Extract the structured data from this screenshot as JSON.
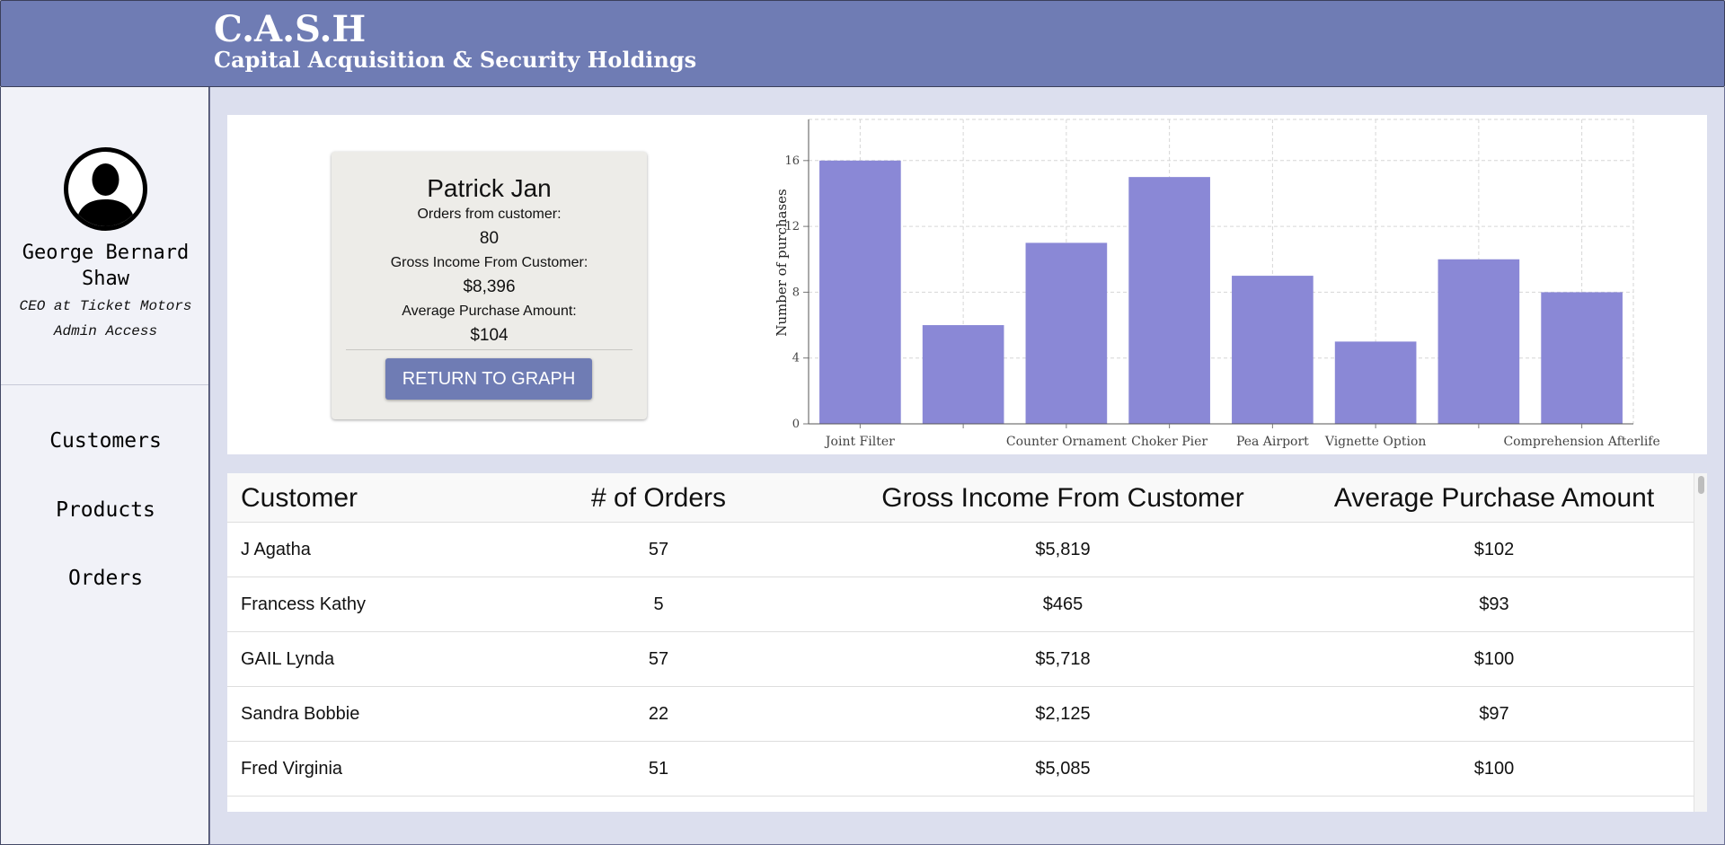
{
  "header": {
    "title": "C.A.S.H",
    "subtitle": "Capital Acquisition & Security Holdings"
  },
  "profile": {
    "name": "George Bernard Shaw",
    "role": "CEO at Ticket Motors",
    "access": "Admin Access",
    "avatar_icon": "user-silhouette-icon"
  },
  "nav": {
    "items": [
      {
        "label": "Customers"
      },
      {
        "label": "Products"
      },
      {
        "label": "Orders"
      }
    ]
  },
  "customer_card": {
    "name": "Patrick Jan",
    "orders_label": "Orders from customer:",
    "orders_value": "80",
    "gross_label": "Gross Income From Customer:",
    "gross_value": "$8,396",
    "avg_label": "Average Purchase Amount:",
    "avg_value": "$104",
    "button_label": "RETURN TO GRAPH"
  },
  "chart_data": {
    "type": "bar",
    "categories": [
      "Joint Filter",
      "",
      "Counter Ornament",
      "Choker Pier",
      "Pea Airport",
      "Vignette Option",
      "",
      "Comprehension Afterlife"
    ],
    "values": [
      16,
      6,
      11,
      15,
      9,
      5,
      10,
      8
    ],
    "ylabel": "Number of purchases",
    "xlabel": "",
    "ylim": [
      0,
      18.5
    ],
    "yticks": [
      0,
      4,
      8,
      12,
      16
    ],
    "grid": true,
    "bar_color": "#8a88d6"
  },
  "table": {
    "headers": {
      "customer": "Customer",
      "orders": "# of Orders",
      "gross": "Gross Income From Customer",
      "avg": "Average Purchase Amount"
    },
    "rows": [
      {
        "customer": "J Agatha",
        "orders": "57",
        "gross": "$5,819",
        "avg": "$102"
      },
      {
        "customer": "Francess Kathy",
        "orders": "5",
        "gross": "$465",
        "avg": "$93"
      },
      {
        "customer": "GAIL Lynda",
        "orders": "57",
        "gross": "$5,718",
        "avg": "$100"
      },
      {
        "customer": "Sandra Bobbie",
        "orders": "22",
        "gross": "$2,125",
        "avg": "$97"
      },
      {
        "customer": "Fred Virginia",
        "orders": "51",
        "gross": "$5,085",
        "avg": "$100"
      }
    ]
  },
  "colors": {
    "brand": "#6f7cb4",
    "bar": "#8a88d6",
    "background": "#dcdfee"
  }
}
